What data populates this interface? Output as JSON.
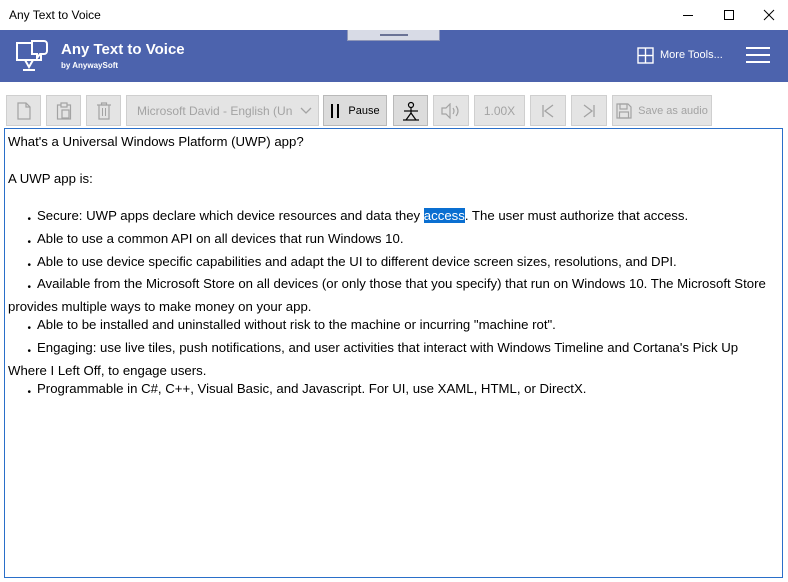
{
  "window": {
    "title": "Any Text to Voice",
    "controls": [
      "minimize-icon",
      "maximize-icon",
      "close-icon"
    ]
  },
  "header": {
    "app_name": "Any Text to Voice",
    "app_sub": "by AnywaySoft",
    "more_tools": "More Tools...",
    "background": "#4c63ad"
  },
  "toolbar": {
    "voice": "Microsoft David - English (United States)",
    "pause_label": "Pause",
    "speed": "1.00X",
    "save_label": "Save as audio"
  },
  "document": {
    "heading": "What's a Universal Windows Platform (UWP) app?",
    "intro": "A UWP app is:",
    "bullet_glyph": "•",
    "items": [
      {
        "before": "Secure: UWP apps declare which device resources and data they ",
        "selected": "access",
        "after": ". The user must authorize that access."
      },
      {
        "text": "Able to use a common API on all devices that run Windows 10."
      },
      {
        "text": "Able to use device specific capabilities and adapt the UI to different device screen sizes, resolutions, and DPI."
      },
      {
        "text": "Available from the Microsoft Store on all devices (or only those that you specify) that run on Windows 10. The Microsoft Store provides multiple ways to make money on your app."
      },
      {
        "text": "Able to be installed and uninstalled without risk to the machine or incurring \"machine rot\"."
      },
      {
        "text": "Engaging: use live tiles, push notifications, and user activities that interact with Windows Timeline and Cortana's Pick Up Where I Left Off, to engage users."
      },
      {
        "text": "Programmable in C#, C++, Visual Basic, and Javascript. For UI, use XAML, HTML, or DirectX."
      }
    ]
  }
}
